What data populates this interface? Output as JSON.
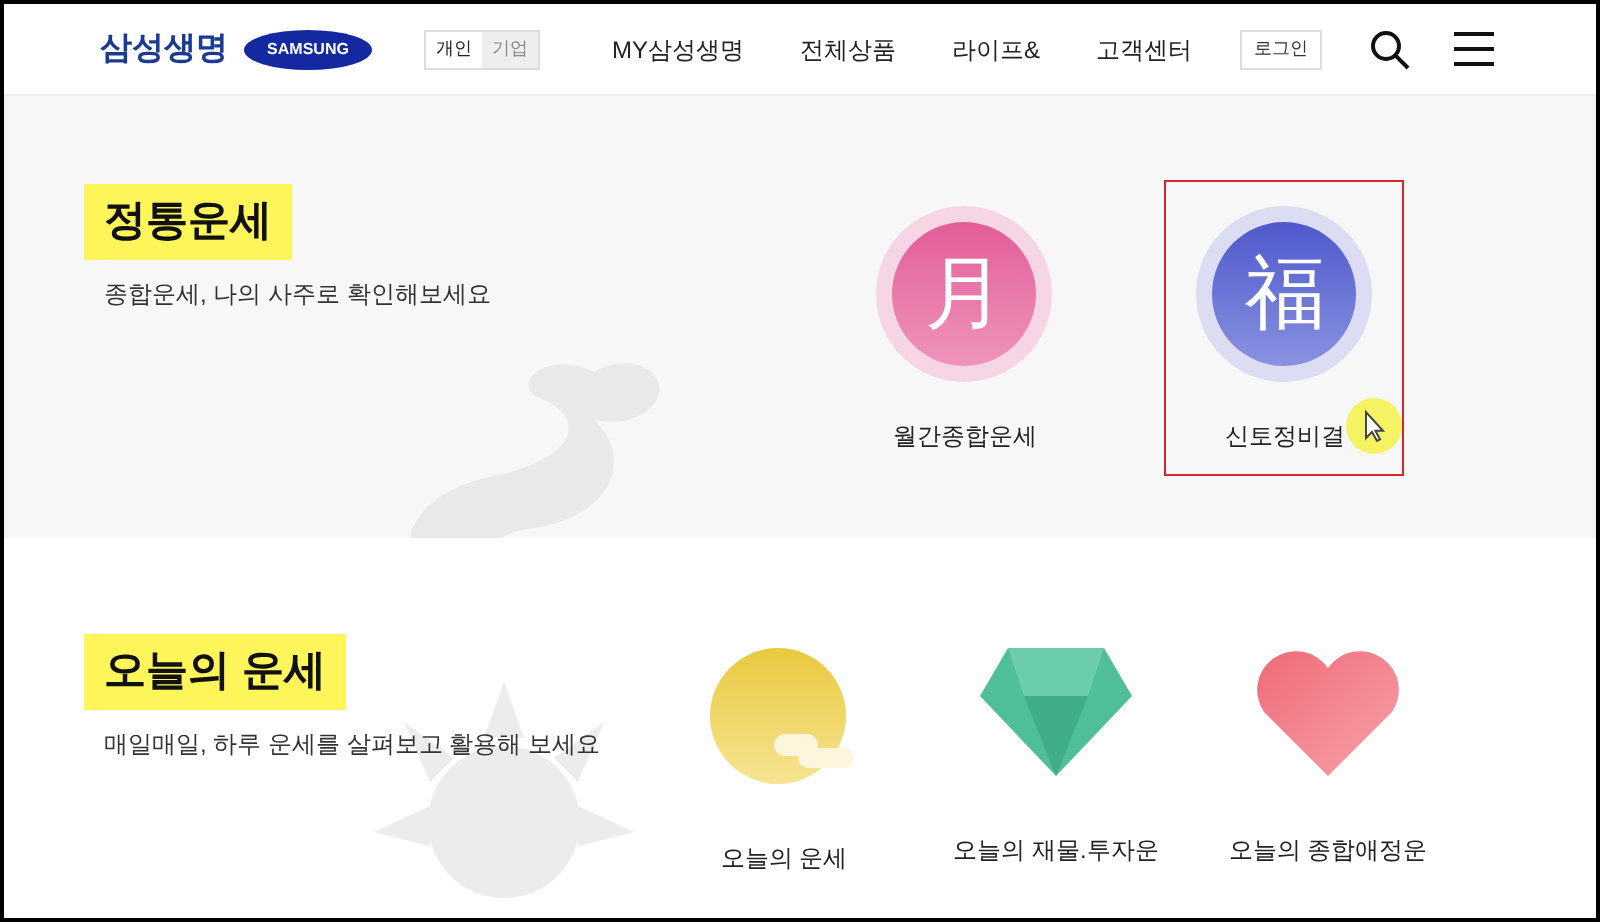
{
  "header": {
    "logo_text": "삼성생명",
    "brand_badge": "SAMSUNG",
    "segments": [
      {
        "label": "개인",
        "selected": true
      },
      {
        "label": "기업",
        "selected": false
      }
    ],
    "nav": [
      "MY삼성생명",
      "전체상품",
      "라이프&",
      "고객센터"
    ],
    "login": "로그인"
  },
  "sections": [
    {
      "title": "정통운세",
      "subtitle": "종합운세, 나의 사주로 확인해보세요",
      "art": {
        "kind": "dragon"
      },
      "items": [
        {
          "kind": "moon",
          "glyph": "月",
          "label": "월간종합운세",
          "selected": false
        },
        {
          "kind": "fortune",
          "glyph": "福",
          "label": "신토정비결",
          "selected": true
        }
      ]
    },
    {
      "title": "오늘의 운세",
      "subtitle": "매일매일, 하루 운세를 살펴보고 활용해 보세요",
      "art": {
        "kind": "sun"
      },
      "items": [
        {
          "kind": "sun",
          "label": "오늘의 운세",
          "selected": false
        },
        {
          "kind": "gem",
          "label": "오늘의 재물.투자운",
          "selected": false
        },
        {
          "kind": "heart",
          "label": "오늘의 종합애정운",
          "selected": false
        }
      ]
    }
  ]
}
